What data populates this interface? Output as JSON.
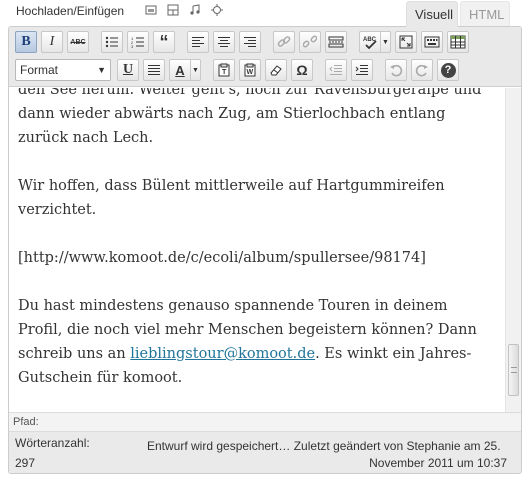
{
  "top": {
    "upload_label": "Hochladen/Einfügen",
    "media_icons": [
      "image-icon",
      "gallery-icon",
      "audio-icon",
      "star-icon"
    ],
    "tab_visual": "Visuell",
    "tab_html": "HTML"
  },
  "toolbar": {
    "bold": "B",
    "italic": "I",
    "strike": "ABC",
    "quote": "“",
    "format_select": "Format",
    "underline": "U",
    "text_color": "A",
    "special_char": "Ω",
    "help": "?"
  },
  "content": {
    "para1": "den See herum. Weiter geht's, noch zur Ravensburgeralpe und dann wieder abwärts nach Zug, am Stierlochbach entlang zurück nach Lech.",
    "para2": "Wir hoffen, dass Bülent mittlerweile auf Hartgummireifen verzichtet.",
    "para3": "[http://www.komoot.de/c/ecoli/album/spullersee/98174]",
    "para4_before": "Du hast mindestens genauso spannende Touren in deinem Profil, die noch viel mehr Menschen begeistern können? Dann schreib uns an ",
    "para4_link": "lieblingstour@komoot.de",
    "para4_after": ". Es winkt ein Jahres-Gutschein für komoot."
  },
  "pathbar": {
    "label": "Pfad:"
  },
  "status": {
    "wordcount_label": "Wörteranzahl:",
    "wordcount_value": "297",
    "autosave_line1": "Entwurf wird gespeichert… Zuletzt geändert von Stephanie am 25.",
    "autosave_line2": "November 2011 um 10:37"
  },
  "colors": {
    "link": "#21759b",
    "toolbar_bg": "#e9e9e9"
  }
}
